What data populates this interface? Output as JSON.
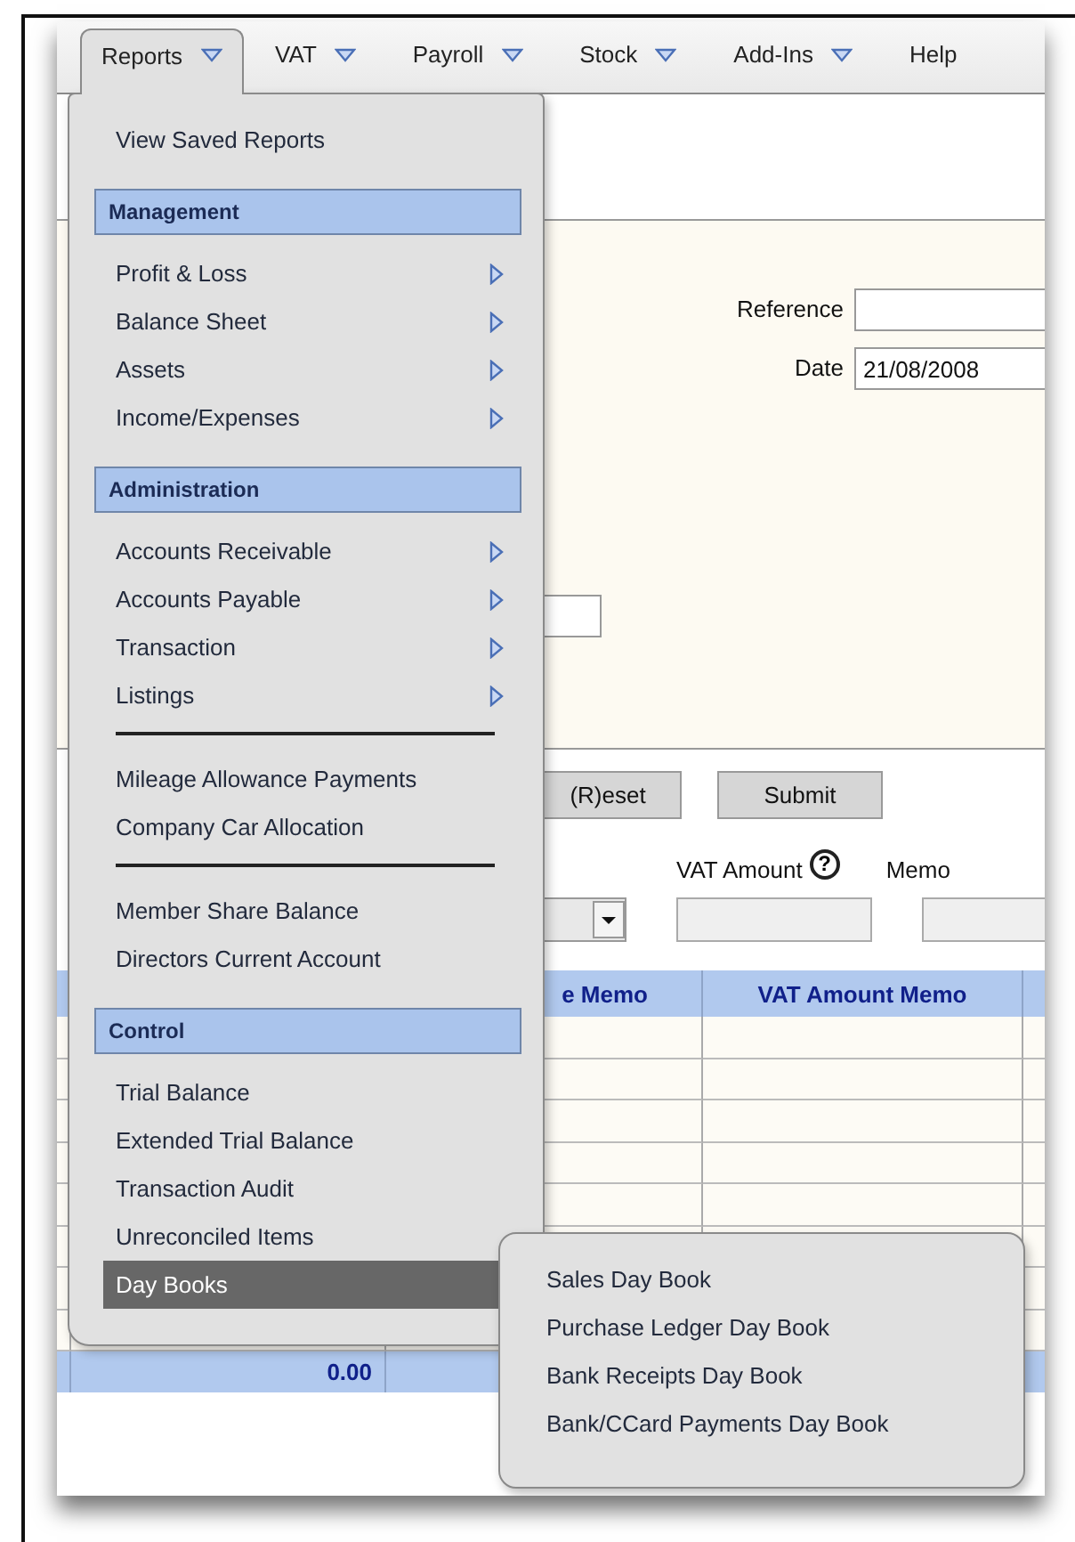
{
  "menu_bar": [
    {
      "label": "Reports",
      "selected": true,
      "dropdown": true
    },
    {
      "label": "VAT",
      "selected": false,
      "dropdown": true
    },
    {
      "label": "Payroll",
      "selected": false,
      "dropdown": true
    },
    {
      "label": "Stock",
      "selected": false,
      "dropdown": true
    },
    {
      "label": "Add-Ins",
      "selected": false,
      "dropdown": true
    },
    {
      "label": "Help",
      "selected": false,
      "dropdown": false
    }
  ],
  "reports_menu": {
    "items": [
      {
        "kind": "item",
        "label": "View Saved Reports",
        "submenu": false,
        "selected": false
      },
      {
        "kind": "header",
        "label": "Management"
      },
      {
        "kind": "item",
        "label": "Profit & Loss",
        "submenu": true,
        "selected": false
      },
      {
        "kind": "item",
        "label": "Balance Sheet",
        "submenu": true,
        "selected": false
      },
      {
        "kind": "item",
        "label": "Assets",
        "submenu": true,
        "selected": false
      },
      {
        "kind": "item",
        "label": "Income/Expenses",
        "submenu": true,
        "selected": false
      },
      {
        "kind": "header",
        "label": "Administration"
      },
      {
        "kind": "item",
        "label": "Accounts Receivable",
        "submenu": true,
        "selected": false
      },
      {
        "kind": "item",
        "label": "Accounts Payable",
        "submenu": true,
        "selected": false
      },
      {
        "kind": "item",
        "label": "Transaction",
        "submenu": true,
        "selected": false
      },
      {
        "kind": "item",
        "label": "Listings",
        "submenu": true,
        "selected": false
      },
      {
        "kind": "separator"
      },
      {
        "kind": "item",
        "label": "Mileage Allowance Payments",
        "submenu": false,
        "selected": false
      },
      {
        "kind": "item",
        "label": "Company Car Allocation",
        "submenu": false,
        "selected": false
      },
      {
        "kind": "separator"
      },
      {
        "kind": "item",
        "label": "Member Share Balance",
        "submenu": false,
        "selected": false
      },
      {
        "kind": "item",
        "label": "Directors Current Account",
        "submenu": false,
        "selected": false
      },
      {
        "kind": "header",
        "label": "Control"
      },
      {
        "kind": "item",
        "label": "Trial Balance",
        "submenu": false,
        "selected": false
      },
      {
        "kind": "item",
        "label": "Extended Trial Balance",
        "submenu": false,
        "selected": false
      },
      {
        "kind": "item",
        "label": "Transaction Audit",
        "submenu": false,
        "selected": false
      },
      {
        "kind": "item",
        "label": "Unreconciled Items",
        "submenu": false,
        "selected": false
      },
      {
        "kind": "item",
        "label": "Day Books",
        "submenu": false,
        "selected": true
      }
    ]
  },
  "day_books_submenu": {
    "items": [
      "Sales Day Book",
      "Purchase Ledger Day Book",
      "Bank Receipts Day Book",
      "Bank/CCard Payments Day Book"
    ]
  },
  "form": {
    "reference": {
      "label": "Reference"
    },
    "date": {
      "label": "Date",
      "value": "21/08/2008"
    }
  },
  "buttons": [
    "(R)eset",
    "Submit"
  ],
  "entry_fields": [
    {
      "label": "VAT Amount",
      "help": "?"
    },
    {
      "label": "Memo"
    }
  ],
  "table": {
    "columns": [
      "e Memo",
      "VAT Amount Memo"
    ],
    "total": "0.00"
  }
}
